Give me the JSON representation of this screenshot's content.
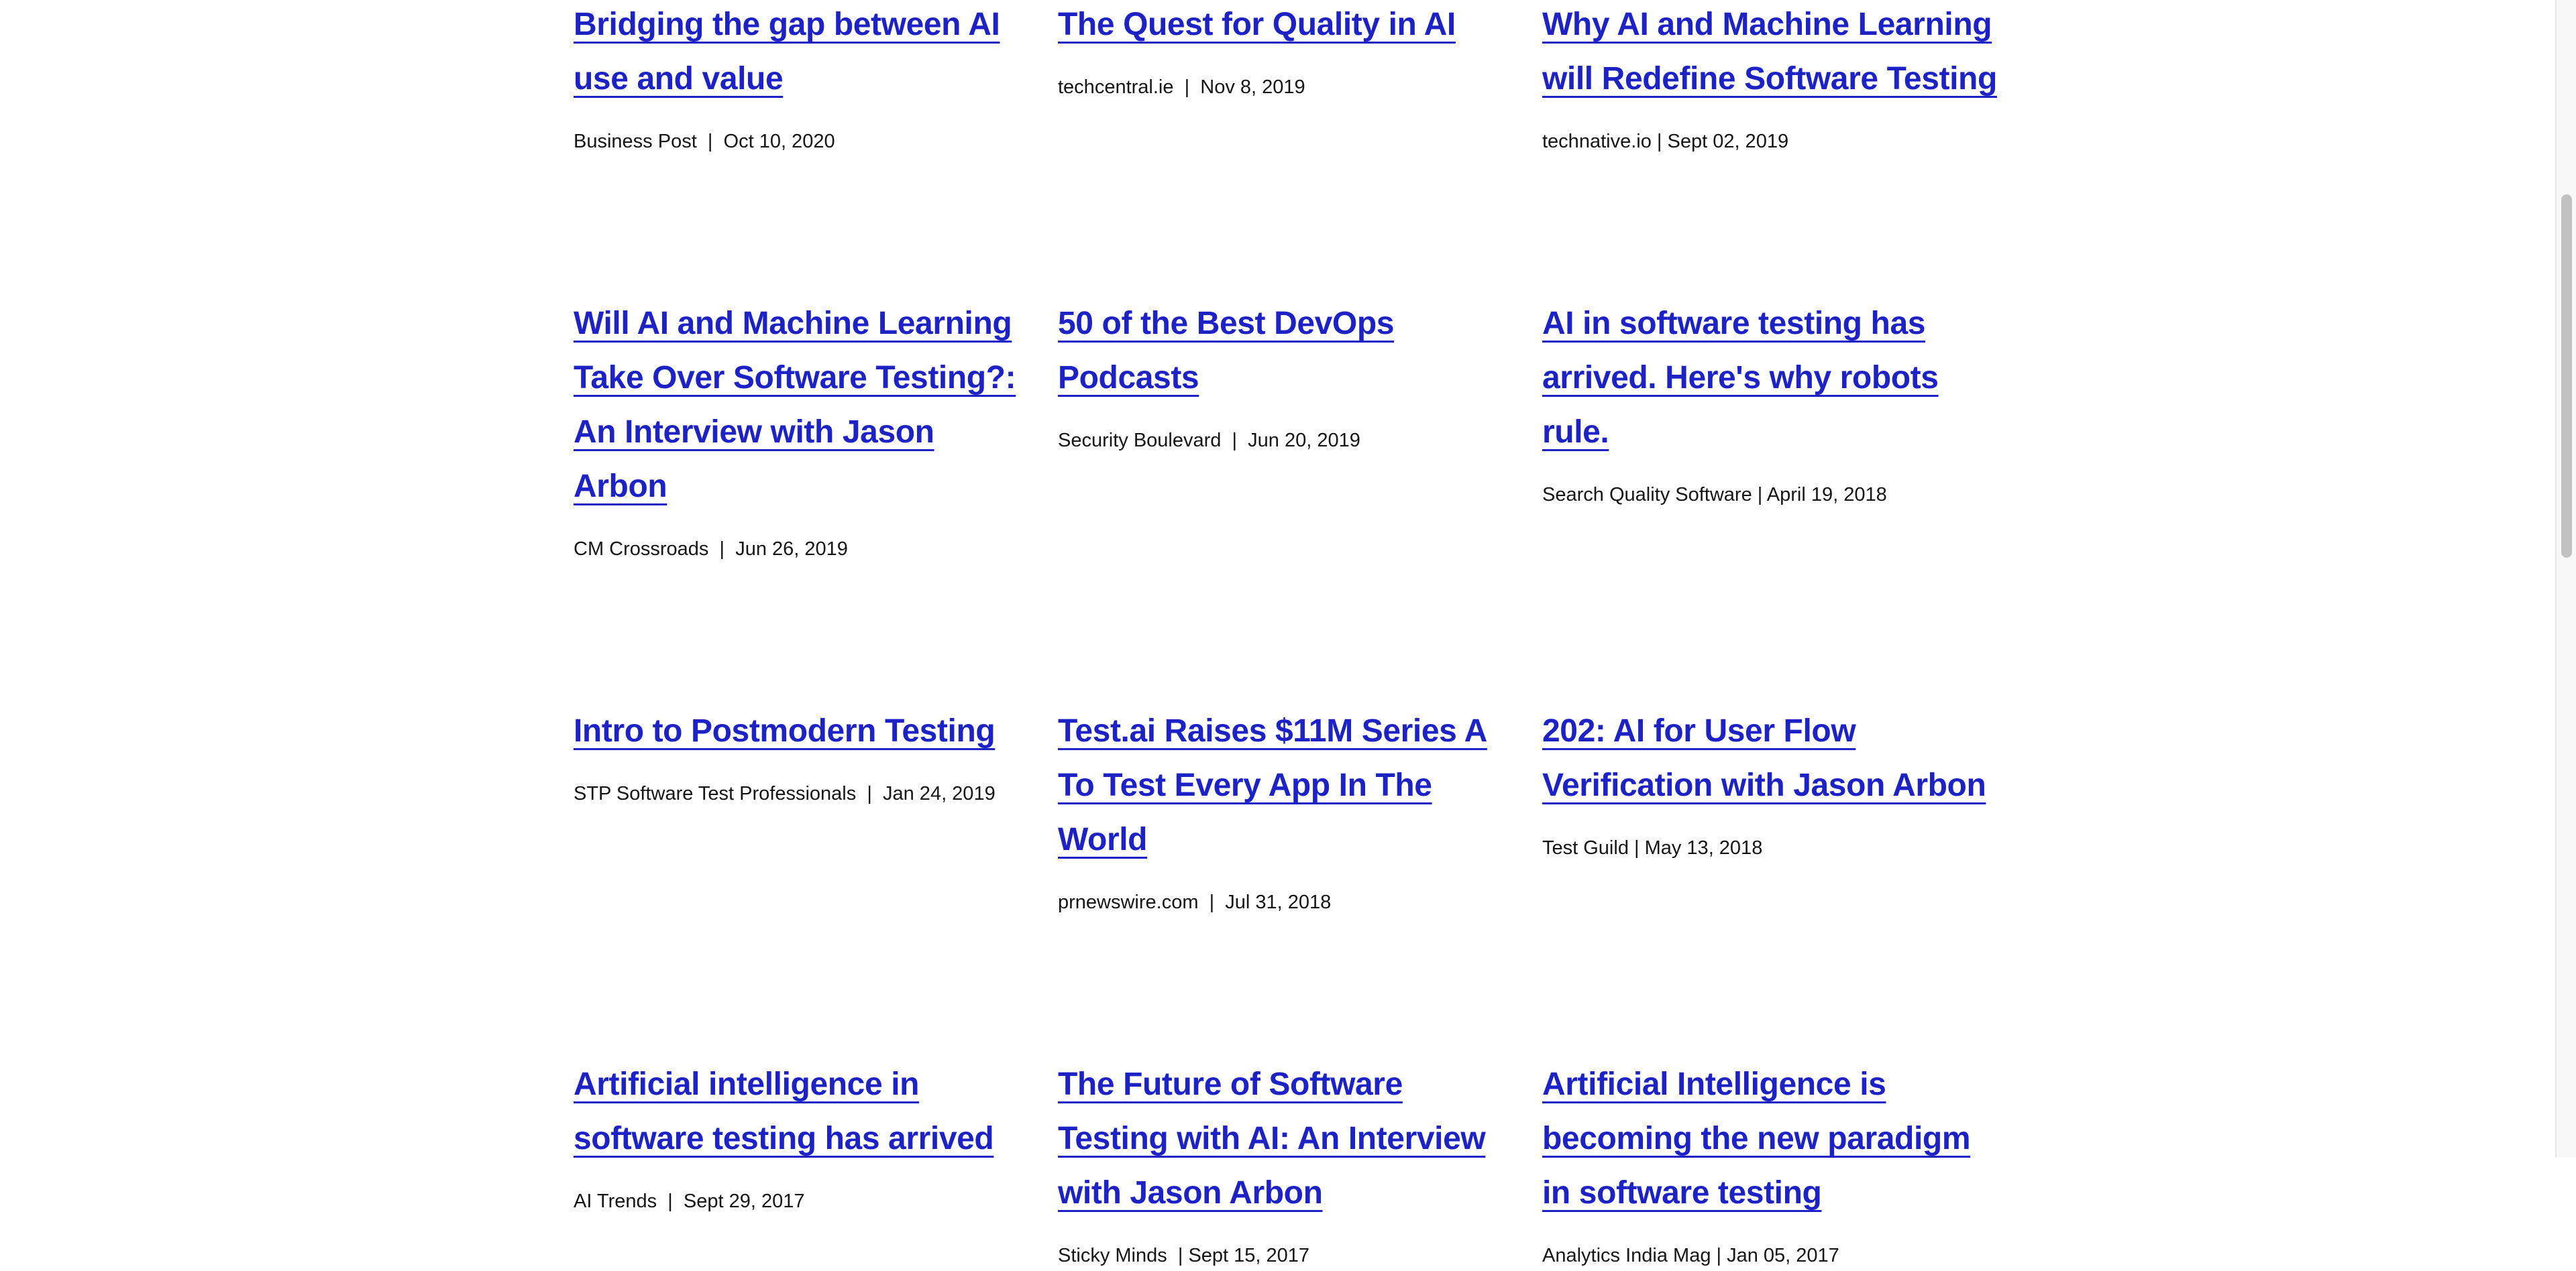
{
  "colors": {
    "link": "#1c22c4",
    "meta_text": "#161616",
    "background": "#ffffff"
  },
  "articles": [
    {
      "title": "Bridging the gap between AI use and value",
      "meta": "Business Post  |  Oct 10, 2020"
    },
    {
      "title": "The Quest for Quality in AI",
      "meta": "techcentral.ie  |  Nov 8, 2019"
    },
    {
      "title": "Why AI and Machine Learning will Redefine Software Testing",
      "meta": "technative.io | Sept 02, 2019"
    },
    {
      "title": "Will AI and Machine Learning Take Over Software Testing?: An Interview with Jason Arbon",
      "meta": "CM Crossroads  |  Jun 26, 2019"
    },
    {
      "title": "50 of the Best DevOps Podcasts",
      "meta": "Security Boulevard  |  Jun 20, 2019"
    },
    {
      "title": "AI in software testing has arrived. Here's why robots rule.",
      "meta": "Search Quality Software | April 19, 2018"
    },
    {
      "title": "Intro to Postmodern Testing",
      "meta": "STP Software Test Professionals  |  Jan 24, 2019"
    },
    {
      "title": "Test.ai Raises $11M Series A To Test Every App In The World",
      "meta": "prnewswire.com  |  Jul 31, 2018"
    },
    {
      "title": "202: AI for User Flow Verification with Jason Arbon",
      "meta": "Test Guild | May 13, 2018"
    },
    {
      "title": "Artificial intelligence in software testing has arrived",
      "meta": "AI Trends  |  Sept 29, 2017"
    },
    {
      "title": "The Future of Software Testing with AI: An Interview with Jason Arbon",
      "meta": "Sticky Minds  | Sept 15, 2017"
    },
    {
      "title": "Artificial Intelligence is becoming the new paradigm in software testing",
      "meta": "Analytics India Mag | Jan 05, 2017"
    }
  ],
  "scrollbar": {
    "scroll_position_fraction": 0.2,
    "visible_fraction": 0.31
  }
}
